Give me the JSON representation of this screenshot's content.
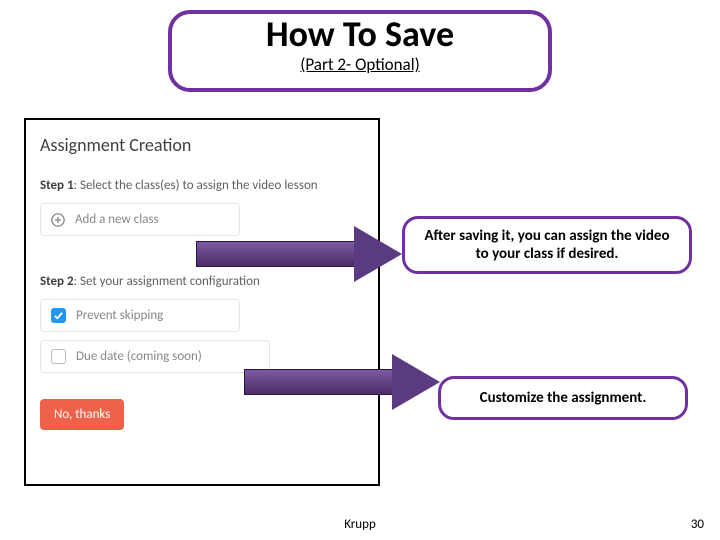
{
  "title": {
    "main": "How To Save",
    "sub": "(Part 2- Optional)"
  },
  "screenshot": {
    "heading": "Assignment Creation",
    "step1_prefix": "Step 1",
    "step1_text": ": Select the class(es) to assign the video lesson",
    "add_class": "Add a new class",
    "step2_prefix": "Step 2",
    "step2_text": ": Set your assignment configuration",
    "opt_prevent": "Prevent skipping",
    "opt_due": "Due date (coming soon)",
    "no_thanks": "No, thanks"
  },
  "callouts": {
    "c1": "After saving it, you can assign the video to your class if desired.",
    "c2": "Customize the assignment."
  },
  "footer": {
    "author": "Krupp",
    "page": "30"
  }
}
